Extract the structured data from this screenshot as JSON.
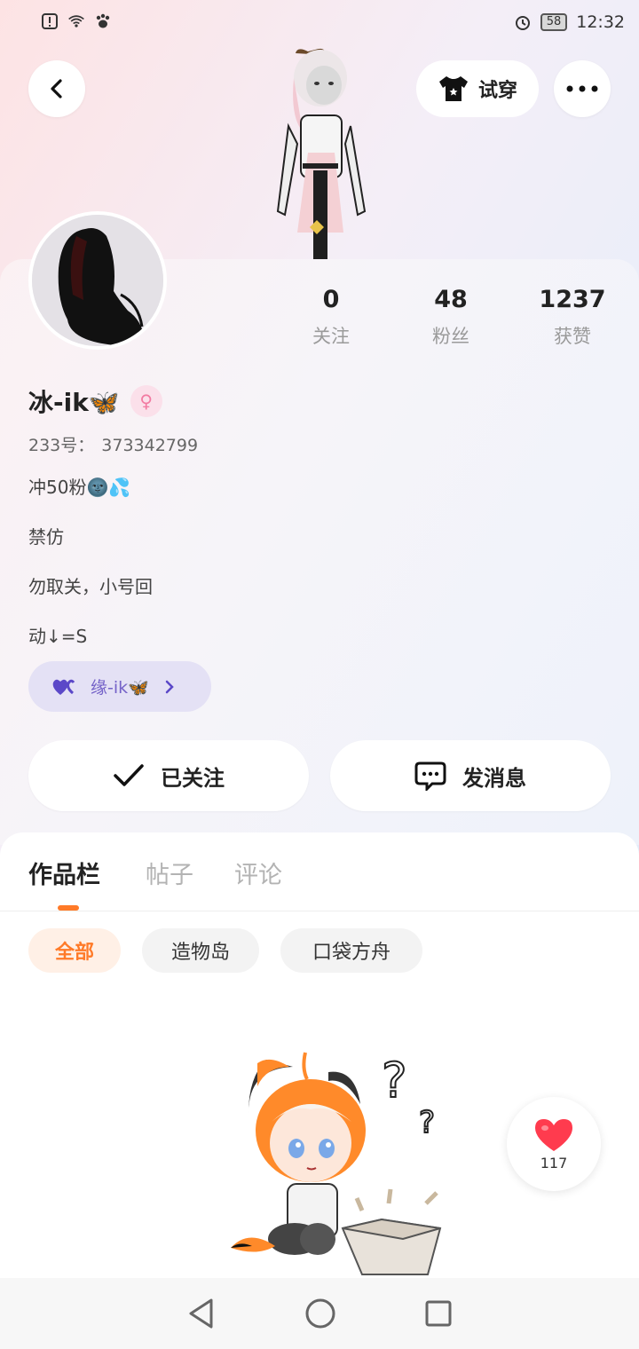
{
  "status_bar": {
    "battery": "58",
    "time": "12:32",
    "icons": [
      "alert-icon",
      "wifi-icon",
      "paw-icon",
      "alarm-icon"
    ]
  },
  "header": {
    "try_on_label": "试穿",
    "icons": [
      "back-arrow-icon",
      "tshirt-icon",
      "more-icon"
    ]
  },
  "profile": {
    "stats": [
      {
        "value": "0",
        "label": "关注"
      },
      {
        "value": "48",
        "label": "粉丝"
      },
      {
        "value": "1237",
        "label": "获赞"
      }
    ],
    "name": "冰-ik🦋",
    "gender_symbol": "♀",
    "uid_label": "233号：",
    "uid_value": "373342799",
    "bio": [
      "冲50粉🌚💦",
      "禁仿",
      "勿取关，小号回",
      "动↓=S"
    ],
    "couple": {
      "icon": "heart-icon",
      "label": "缘-ik🦋"
    }
  },
  "actions": {
    "follow_label": "已关注",
    "message_label": "发消息"
  },
  "tabs": [
    {
      "label": "作品栏",
      "active": true
    },
    {
      "label": "帖子",
      "active": false
    },
    {
      "label": "评论",
      "active": false
    }
  ],
  "filters": [
    {
      "label": "全部",
      "active": true
    },
    {
      "label": "造物岛",
      "active": false
    },
    {
      "label": "口袋方舟",
      "active": false
    }
  ],
  "like": {
    "count": "117"
  },
  "colors": {
    "accent": "#ff7a28",
    "couple_bg": "#e4e1f5",
    "couple_text": "#7462c8",
    "gender": "#f27ba2",
    "like_heart": "#ff3b4e"
  }
}
